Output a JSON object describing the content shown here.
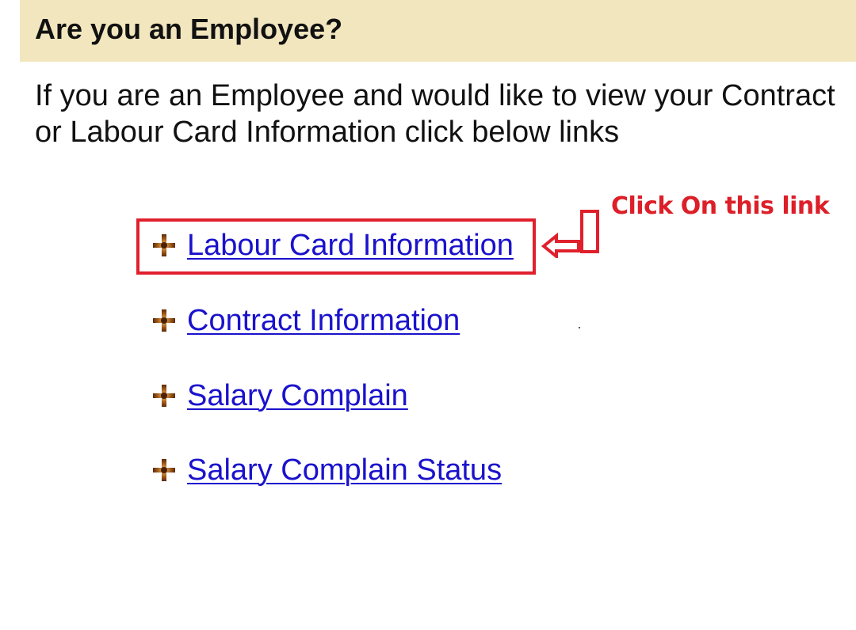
{
  "header": {
    "title": "Are you an Employee?"
  },
  "intro": {
    "line1": "If you are an Employee and would like to view your Contract",
    "line2": "or Labour Card Information click below links"
  },
  "links": [
    {
      "label": "Labour Card Information",
      "icon": "brown-cross-bullet-icon"
    },
    {
      "label": "Contract Information",
      "icon": "brown-cross-bullet-icon"
    },
    {
      "label": "Salary Complain",
      "icon": "brown-cross-bullet-icon"
    },
    {
      "label": "Salary Complain Status",
      "icon": "brown-cross-bullet-icon"
    }
  ],
  "annotation": {
    "callout": "Click On this link",
    "color": "#e0202d"
  },
  "colors": {
    "header_bg": "#f2e6bf",
    "link": "#1a12cc",
    "bullet": "#8a4a12"
  }
}
